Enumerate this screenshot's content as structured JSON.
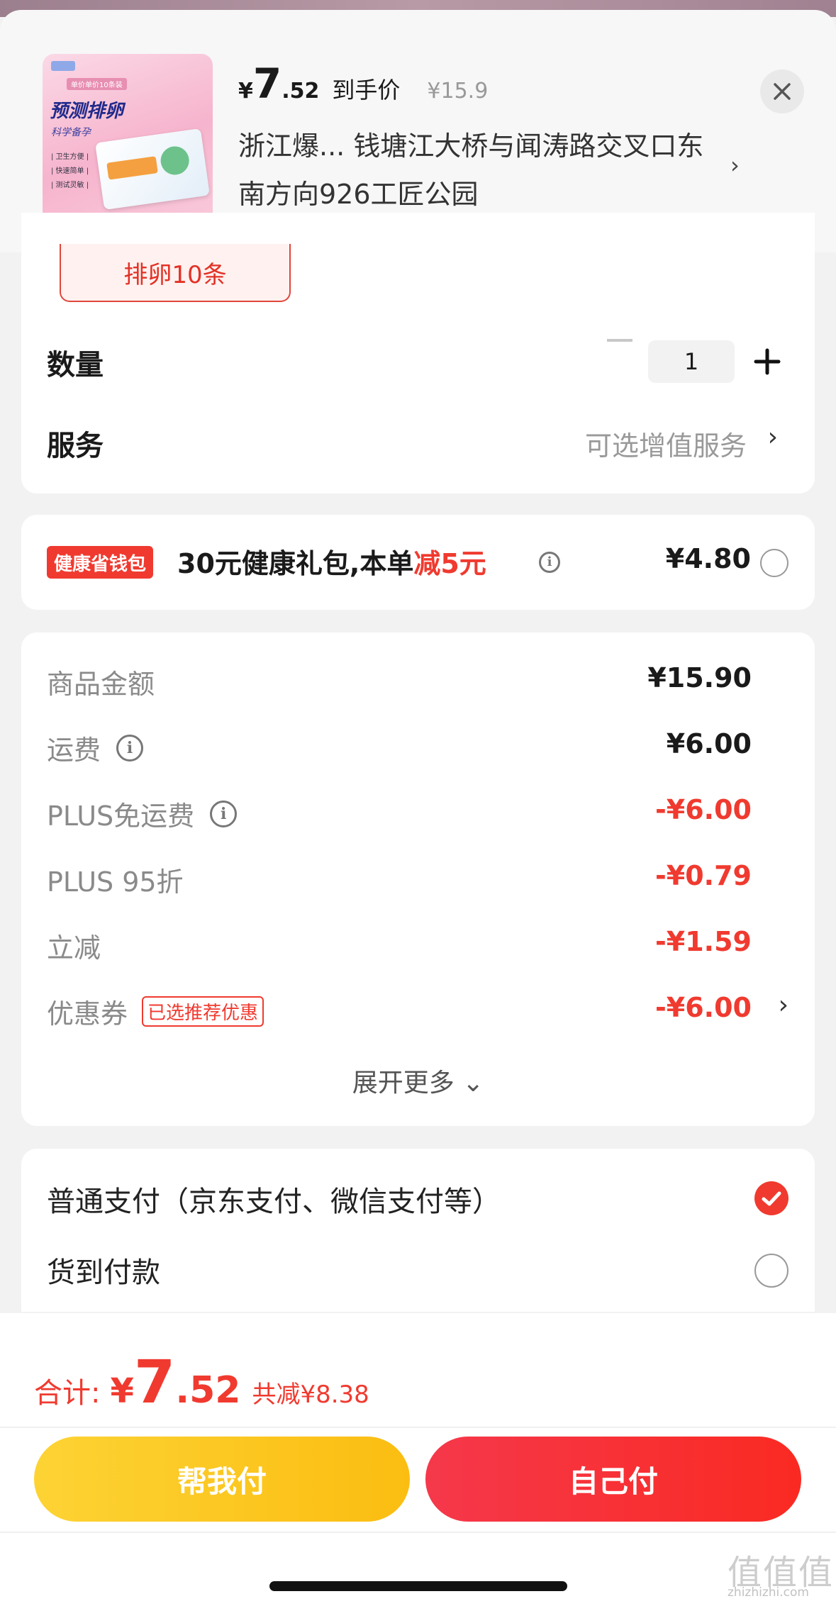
{
  "header": {
    "currency_symbol": "¥",
    "price_integer": "7",
    "price_decimal": ".52",
    "price_caption": "到手价",
    "original_price": "¥15.9",
    "address": "浙江爆...  钱塘江大桥与闻涛路交叉口东南方向926工匠公园",
    "address_chevron": "›",
    "close_icon": "close-icon"
  },
  "product_image": {
    "tagline": "单价单价10条装",
    "title": "预测排卵",
    "subtitle": "科学备孕",
    "bullets": [
      "| 卫生方便 |",
      "| 快速简单 |",
      "| 测试灵敏 |"
    ]
  },
  "spec": {
    "selected": "排卵10条"
  },
  "quantity": {
    "label": "数量",
    "value": "1",
    "minus": "−",
    "plus": "+"
  },
  "service": {
    "label": "服务",
    "value": "可选增值服务",
    "chevron": "›"
  },
  "health_bag": {
    "badge": "健康省钱包",
    "desc_part1": "30元健康礼包,本单",
    "desc_part2": "减5元",
    "info": "i",
    "price": "¥4.80"
  },
  "fees": {
    "goods_label": "商品金额",
    "goods_value": "¥15.90",
    "shipping_label": "运费",
    "shipping_value": "¥6.00",
    "plus_free_label": "PLUS免运费",
    "plus_free_value": "-¥6.00",
    "plus_discount_label": "PLUS 95折",
    "plus_discount_value": "-¥0.79",
    "instant_label": "立减",
    "instant_value": "-¥1.59",
    "coupon_label": "优惠券",
    "coupon_tag": "已选推荐优惠",
    "coupon_value": "-¥6.00",
    "chevron": "›",
    "info": "i",
    "expand": "展开更多 ⌄"
  },
  "payment": {
    "normal": "普通支付（京东支付、微信支付等）",
    "cod": "货到付款"
  },
  "footer": {
    "total_label": "合计:",
    "total_yen": "¥",
    "total_int": "7",
    "total_dec": ".52",
    "total_saved": "共减¥8.38",
    "help_pay": "帮我付",
    "self_pay": "自己付"
  },
  "watermark": {
    "main": "值值值",
    "sub": "zhizhizhi.com"
  },
  "colors": {
    "accent_red": "#f03a2f",
    "yellow_btn": "#fbbd11",
    "red_btn": "#fa2a22"
  }
}
